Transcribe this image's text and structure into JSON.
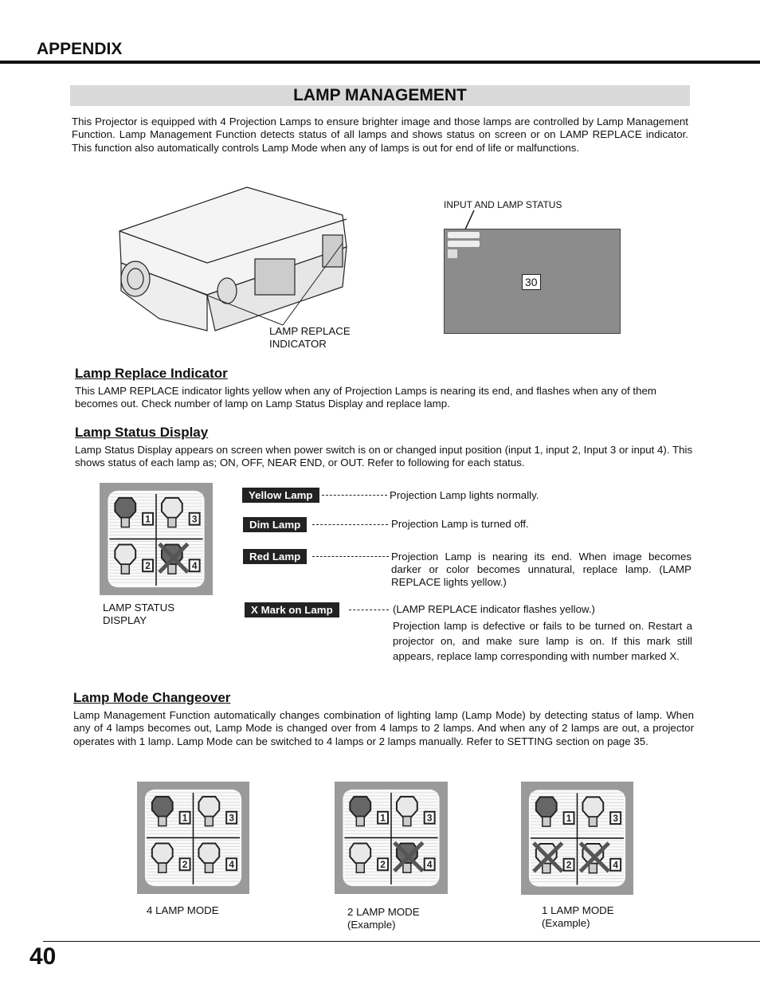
{
  "header": {
    "section": "APPENDIX",
    "title": "LAMP MANAGEMENT"
  },
  "intro": "This Projector is equipped with 4 Projection Lamps to ensure brighter image and those lamps are controlled by Lamp Management Function. Lamp Management Function detects status of all lamps and shows status on screen or on LAMP REPLACE indicator. This function also automatically controls Lamp Mode when any of lamps is out for end of life or malfunctions.",
  "figure": {
    "lamp_replace_indicator": [
      "LAMP REPLACE",
      "INDICATOR"
    ],
    "input_lamp_status": "INPUT AND LAMP STATUS",
    "screen_number": "30"
  },
  "lamp_replace": {
    "heading": "Lamp Replace Indicator",
    "text": "This LAMP REPLACE indicator lights yellow when any of Projection Lamps is nearing its end, and flashes when any of them becomes out.  Check number of  lamp on Lamp Status Display and replace lamp."
  },
  "lamp_status": {
    "heading": "Lamp Status Display",
    "text": "Lamp Status Display appears on screen when power switch is on or changed input position (input 1, input 2, Input 3 or input 4). This shows status of each lamp as; ON, OFF, NEAR END, or OUT. Refer to following for each status.",
    "display_label": [
      "LAMP STATUS",
      "DISPLAY"
    ],
    "legend": [
      {
        "label": "Yellow Lamp",
        "desc": "Projection Lamp lights normally."
      },
      {
        "label": "Dim Lamp",
        "desc": "Projection Lamp is turned off."
      },
      {
        "label": "Red Lamp",
        "desc": "Projection Lamp is nearing its end. When image becomes darker or color becomes unnatural, replace lamp. (LAMP REPLACE lights yellow.)"
      },
      {
        "label": "X Mark on Lamp",
        "desc": "(LAMP REPLACE indicator flashes yellow.)",
        "desc2": "Projection lamp is defective or fails to be turned on. Restart a projector on, and make sure lamp is on. If this mark still appears, replace lamp corresponding with number marked X."
      }
    ]
  },
  "lamp_mode": {
    "heading": "Lamp Mode Changeover",
    "text": "Lamp Management Function automatically changes combination of lighting lamp (Lamp Mode) by detecting status of lamp. When any of 4 lamps becomes out, Lamp Mode is changed over from 4 lamps to 2 lamps. And when any of 2 lamps are out, a projector operates with 1 lamp. Lamp Mode can be switched to 4 lamps or 2 lamps manually. Refer to SETTING section on page 35.",
    "modes": [
      {
        "label": "4 LAMP MODE",
        "sub": ""
      },
      {
        "label": "2 LAMP MODE",
        "sub": "(Example)"
      },
      {
        "label": "1 LAMP MODE",
        "sub": "(Example)"
      }
    ]
  },
  "page_number": "40"
}
